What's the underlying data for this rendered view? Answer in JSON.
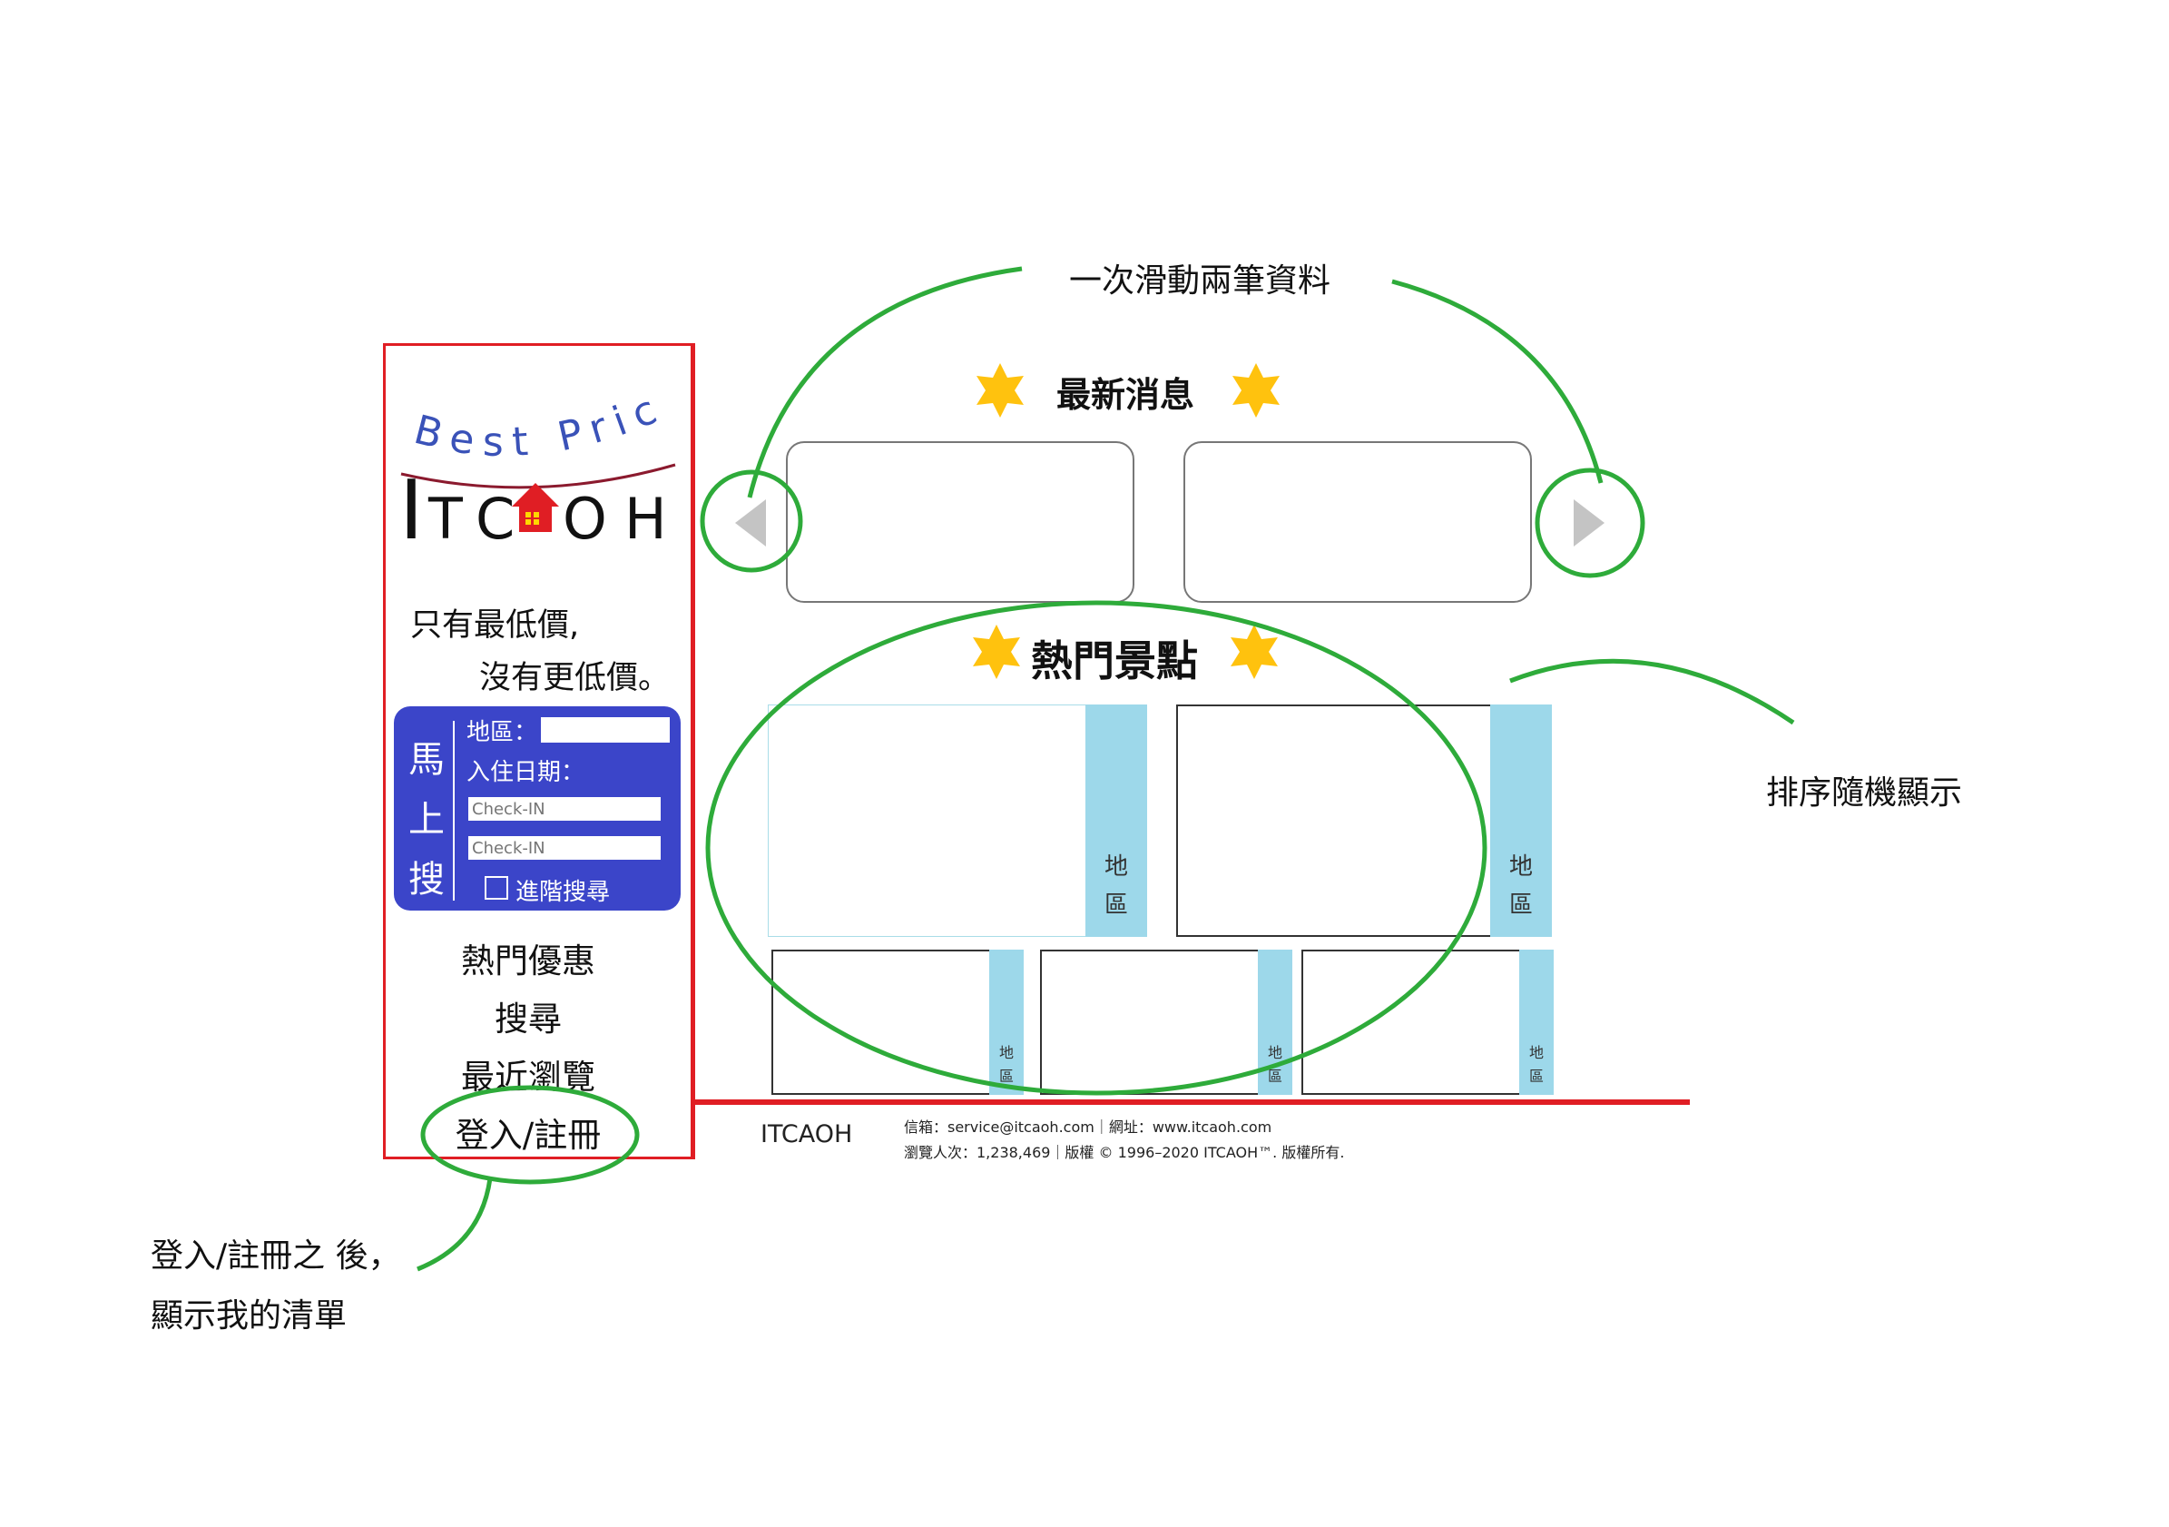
{
  "logo": {
    "tagline": "Best Price",
    "brand_letters": [
      "I",
      "T",
      "C",
      "O",
      "H"
    ]
  },
  "slogan": {
    "line1": "只有最低價,",
    "line2": "沒有更低價。"
  },
  "quick_search": {
    "vertical_title": [
      "馬",
      "上",
      "搜"
    ],
    "region_label": "地區：",
    "region_value": "",
    "date_label": "入住日期：",
    "checkin_placeholder_1": "Check-IN",
    "checkin_placeholder_2": "Check-IN",
    "advanced_label": "進階搜尋"
  },
  "nav": {
    "items": [
      {
        "label": "熱門優惠"
      },
      {
        "label": "搜尋"
      },
      {
        "label": "最近瀏覽"
      },
      {
        "label": "登入/註冊"
      }
    ]
  },
  "news": {
    "title": "最新消息"
  },
  "spots": {
    "title": "熱門景點",
    "region_label_chars": [
      "地",
      "區"
    ]
  },
  "footer": {
    "brand": "ITCAOH",
    "line1": "信箱：service@itcaoh.com｜網址：www.itcaoh.com",
    "line2": "瀏覽人次：1,238,469｜版權 © 1996–2020 ITCAOH™. 版權所有."
  },
  "annotations": {
    "slide": "一次滑動兩筆資料",
    "random": "排序隨機顯示",
    "after_login_1": "登入/註冊之 後，",
    "after_login_2": "顯示我的清單"
  },
  "colors": {
    "accent_red": "#e01e24",
    "search_blue": "#3b45c9",
    "strip_blue": "#9dd8ea",
    "star_yellow": "#ffc20e",
    "annotation_green": "#2eab3a",
    "logo_blue": "#3a52b8",
    "logo_arc": "#8b1a2e"
  }
}
